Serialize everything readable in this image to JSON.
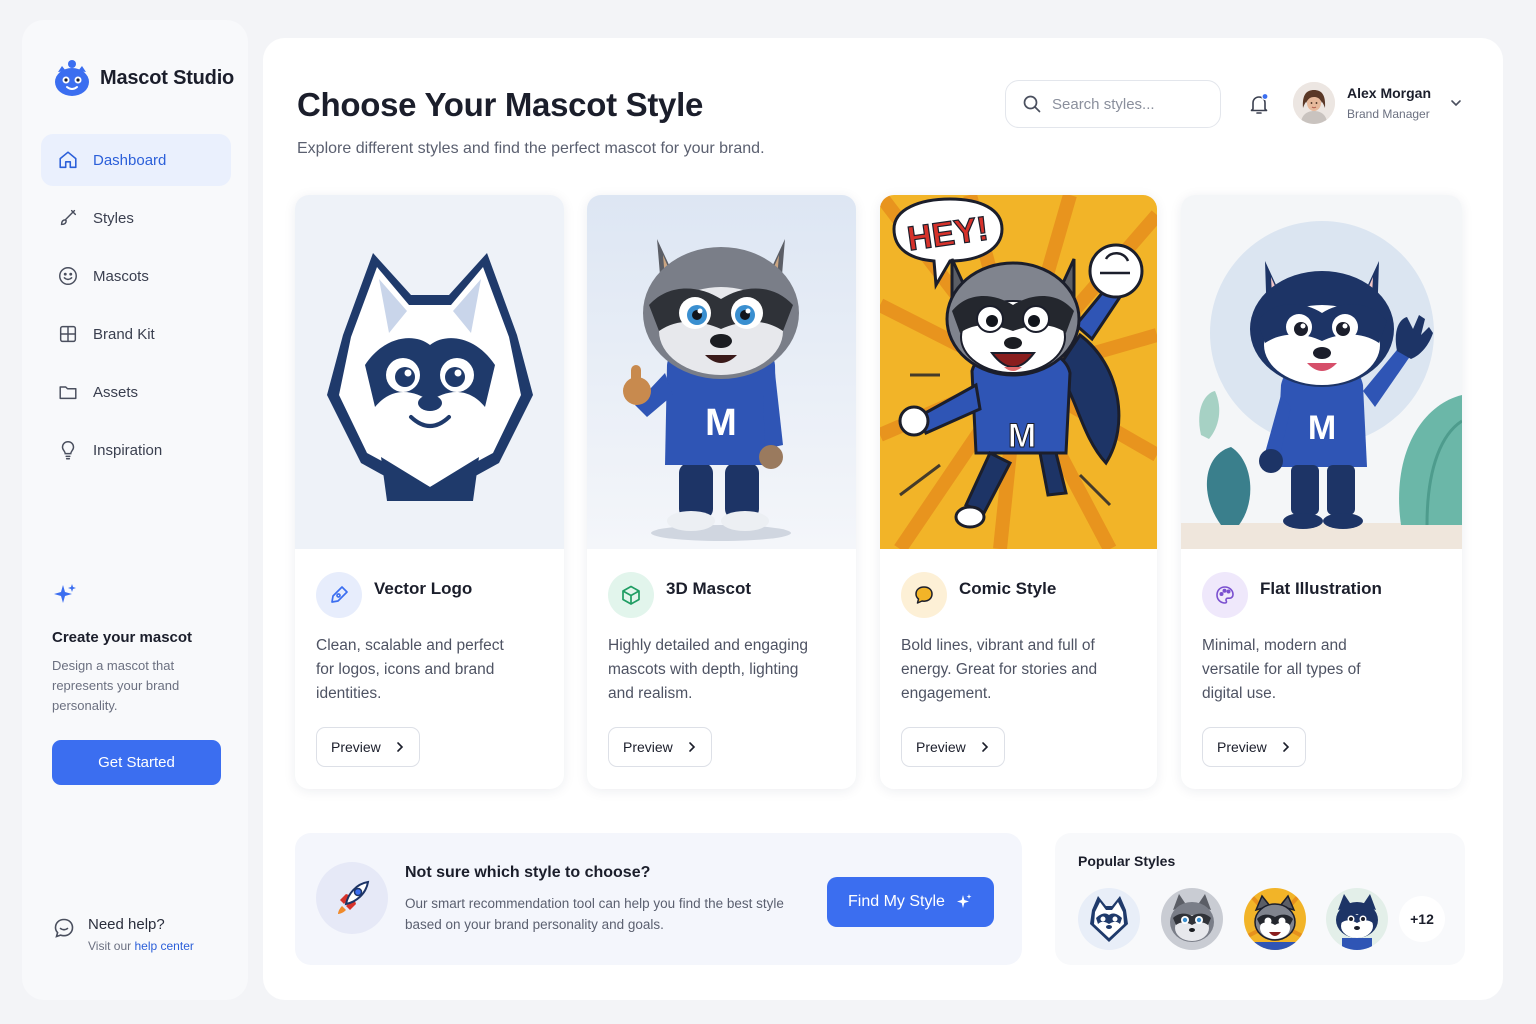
{
  "app": {
    "name": "Mascot Studio"
  },
  "sidebar": {
    "items": [
      {
        "label": "Dashboard",
        "icon": "home-icon",
        "active": true
      },
      {
        "label": "Styles",
        "icon": "brush-icon"
      },
      {
        "label": "Mascots",
        "icon": "smiley-icon"
      },
      {
        "label": "Brand Kit",
        "icon": "grid-icon"
      },
      {
        "label": "Assets",
        "icon": "folder-icon"
      },
      {
        "label": "Inspiration",
        "icon": "lightbulb-icon"
      }
    ],
    "cta": {
      "title": "Create your mascot",
      "description": "Design a mascot that represents your brand personality.",
      "button": "Get Started"
    },
    "help": {
      "title": "Need help?",
      "prefix": "Visit our",
      "link": "help center"
    }
  },
  "header": {
    "title": "Choose Your Mascot Style",
    "subtitle": "Explore different styles and find the perfect mascot for your brand.",
    "search_placeholder": "Search styles...",
    "user": {
      "name": "Alex Morgan",
      "role": "Brand Manager"
    }
  },
  "cards": [
    {
      "title": "Vector Logo",
      "description": "Clean, scalable and perfect for logos, icons and brand identities.",
      "button": "Preview",
      "icon": "pen-icon"
    },
    {
      "title": "3D Mascot",
      "description": "Highly detailed and engaging mascots with depth, lighting and realism.",
      "button": "Preview",
      "icon": "cube-icon"
    },
    {
      "title": "Comic Style",
      "description": "Bold lines, vibrant and full of energy. Great for stories and engagement.",
      "button": "Preview",
      "icon": "speech-bubble-icon",
      "badge_text": "HEY!"
    },
    {
      "title": "Flat Illustration",
      "description": "Minimal, modern and versatile for all types of digital use.",
      "button": "Preview",
      "icon": "palette-icon"
    }
  ],
  "recommendation": {
    "title": "Not sure which style to choose?",
    "description": "Our smart recommendation tool can help you find the best style based on your brand personality and goals.",
    "button": "Find My Style"
  },
  "popular": {
    "title": "Popular Styles",
    "more": "+12"
  },
  "colors": {
    "accent": "#3b6ef0",
    "mascot_navy": "#1f3a6b",
    "hoodie_blue": "#2f55b5",
    "comic_yellow": "#f2b428"
  }
}
